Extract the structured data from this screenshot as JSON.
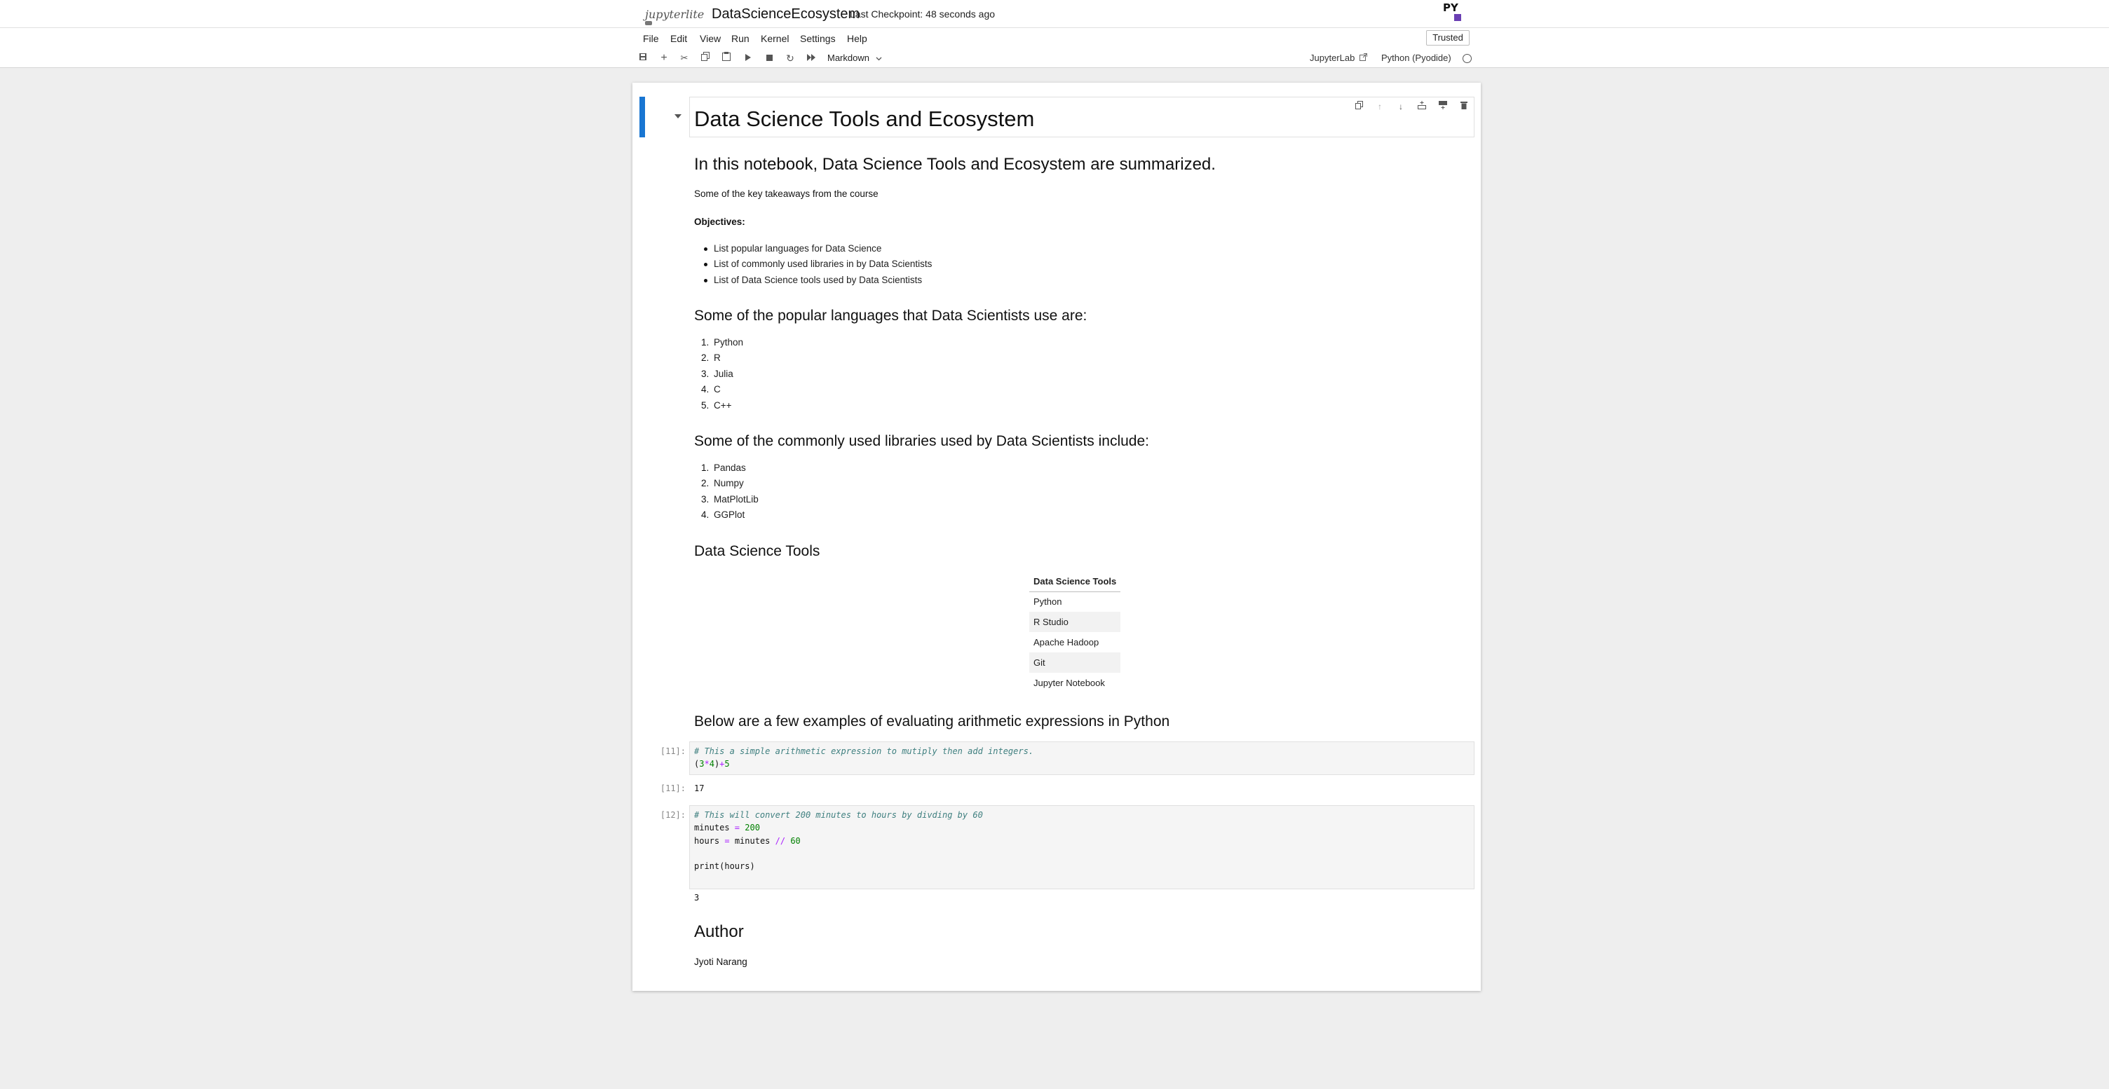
{
  "header": {
    "logo_text": "jupyterlite",
    "notebook_title": "DataScienceEcosystem",
    "checkpoint": "Last Checkpoint: 48 seconds ago",
    "kernel_logo": "PY"
  },
  "menu": {
    "items": [
      "File",
      "Edit",
      "View",
      "Run",
      "Kernel",
      "Settings",
      "Help"
    ],
    "trusted": "Trusted"
  },
  "toolbar": {
    "icons": [
      "save-icon",
      "add-icon",
      "cut-icon",
      "copy-icon",
      "paste-icon",
      "run-icon",
      "stop-icon",
      "restart-icon",
      "fast-forward-icon"
    ],
    "cell_type": "Markdown",
    "jupyterlab_link": "JupyterLab",
    "kernel_name": "Python (Pyodide)"
  },
  "cell_toolbar": {
    "icons": [
      "duplicate-icon",
      "move-up-icon",
      "move-down-icon",
      "insert-above-icon",
      "insert-below-icon",
      "delete-icon"
    ]
  },
  "notebook": {
    "title": "Data Science Tools and Ecosystem",
    "intro_heading": "In this notebook, Data Science Tools and Ecosystem are summarized.",
    "intro_text": "Some of the key takeaways from the course",
    "objectives_label": "Objectives:",
    "objectives": [
      "List popular languages for Data Science",
      "List of commonly used libraries in by Data Scientists",
      "List of Data Science tools used by Data Scientists"
    ],
    "languages_heading": "Some of the popular languages that Data Scientists use are:",
    "languages": [
      "Python",
      "R",
      "Julia",
      "C",
      "C++"
    ],
    "libraries_heading": "Some of the commonly used libraries used by Data Scientists include:",
    "libraries": [
      "Pandas",
      "Numpy",
      "MatPlotLib",
      "GGPlot"
    ],
    "tools_heading": "Data Science Tools",
    "tools_table": {
      "header": "Data Science Tools",
      "rows": [
        "Python",
        "R Studio",
        "Apache Hadoop",
        "Git",
        "Jupyter Notebook"
      ]
    },
    "arith_heading": "Below are a few examples of evaluating arithmetic expressions in Python",
    "code1": {
      "prompt": "[11]:",
      "comment": "# This a simple arithmetic expression to mutiply then add integers.",
      "output_prompt": "[11]:",
      "output": "17"
    },
    "code2": {
      "prompt": "[12]:",
      "comment": "# This will convert 200 minutes to hours by divding by 60",
      "output": "3"
    },
    "author_heading": "Author",
    "author_name": "Jyoti Narang"
  }
}
